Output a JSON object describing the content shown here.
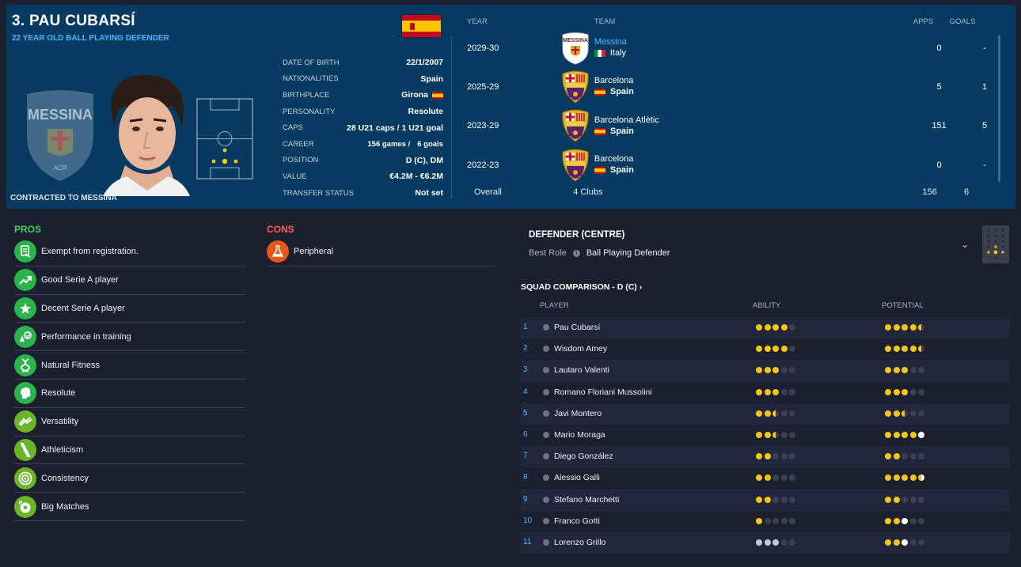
{
  "player": {
    "title": "3. PAU CUBARSÍ",
    "description": "22 YEAR OLD BALL PLAYING DEFENDER",
    "contracted": "CONTRACTED TO MESSINA",
    "nationality_flag": "spain-flag"
  },
  "info": [
    {
      "label": "DATE OF BIRTH",
      "value": "22/1/2007"
    },
    {
      "label": "NATIONALITIES",
      "value": "Spain"
    },
    {
      "label": "BIRTHPLACE",
      "value": "Girona"
    },
    {
      "label": "PERSONALITY",
      "value": "Resolute"
    },
    {
      "label": "CAPS",
      "value": "28 U21 caps / 1 U21 goal"
    },
    {
      "label": "CAREER",
      "games": "156 games /",
      "goals": "6  goals"
    },
    {
      "label": "POSITION",
      "value": "D (C), DM"
    },
    {
      "label": "VALUE",
      "value": "€4.2M - €6.2M"
    },
    {
      "label": "TRANSFER STATUS",
      "value": "Not set"
    }
  ],
  "career": {
    "headers": {
      "year": "YEAR",
      "team": "TEAM",
      "apps": "APPS",
      "goals": "GOALS"
    },
    "rows": [
      {
        "year": "2029-30",
        "team": "Messina",
        "nation": "Italy",
        "apps": "0",
        "goals": "-"
      },
      {
        "year": "2025-29",
        "team": "Barcelona",
        "nation": "Spain",
        "apps": "5",
        "goals": "1"
      },
      {
        "year": "2023-29",
        "team": "Barcelona Atlètic",
        "nation": "Spain",
        "apps": "151",
        "goals": "5"
      },
      {
        "year": "2022-23",
        "team": "Barcelona",
        "nation": "Spain",
        "apps": "0",
        "goals": "-"
      }
    ],
    "overall": {
      "label": "Overall",
      "team": "4 Clubs",
      "apps": "156",
      "goals": "6"
    }
  },
  "pros": {
    "title": "PROS",
    "items": [
      {
        "label": "Exempt from registration.",
        "icon": "document-icon",
        "color": "#2bb34d"
      },
      {
        "label": "Good Serie A player",
        "icon": "trend-up-icon",
        "color": "#2bb34d"
      },
      {
        "label": "Decent Serie A player",
        "icon": "star-icon",
        "color": "#2bb34d"
      },
      {
        "label": "Performance in training",
        "icon": "training-icon",
        "color": "#2bb34d"
      },
      {
        "label": "Natural Fitness",
        "icon": "dna-icon",
        "color": "#2bb34d"
      },
      {
        "label": "Resolute",
        "icon": "head-icon",
        "color": "#2bb34d"
      },
      {
        "label": "Versatility",
        "icon": "arrows-icon",
        "color": "#6ab52a"
      },
      {
        "label": "Athleticism",
        "icon": "bolt-icon",
        "color": "#6ab52a"
      },
      {
        "label": "Consistency",
        "icon": "target-icon",
        "color": "#6ab52a"
      },
      {
        "label": "Big Matches",
        "icon": "ball-icon",
        "color": "#6ab52a"
      }
    ]
  },
  "cons": {
    "title": "CONS",
    "items": [
      {
        "label": "Peripheral",
        "icon": "flask-icon",
        "color": "#e8561b"
      }
    ]
  },
  "position": {
    "title": "DEFENDER (CENTRE)",
    "best_role_label": "Best Role",
    "best_role": "Ball Playing Defender"
  },
  "squad": {
    "title": "SQUAD COMPARISON - D (C)",
    "headers": {
      "player": "PLAYER",
      "ability": "ABILITY",
      "potential": "POTENTIAL"
    },
    "rows": [
      {
        "num": "1",
        "name": "Pau Cubarsí",
        "ability": 4,
        "potential": 4.5
      },
      {
        "num": "2",
        "name": "Wisdom Amey",
        "ability": 4,
        "potential": 4.5
      },
      {
        "num": "3",
        "name": "Lautaro Valenti",
        "ability": 3,
        "potential": 3
      },
      {
        "num": "4",
        "name": "Romano Floriani Mussolini",
        "ability": 3,
        "potential": 3
      },
      {
        "num": "5",
        "name": "Javi Montero",
        "ability": 2.5,
        "potential": 2.5
      },
      {
        "num": "6",
        "name": "Mario Moraga",
        "ability": 2.5,
        "potential": 5,
        "potential_note": "scouted-range"
      },
      {
        "num": "7",
        "name": "Diego González",
        "ability": 2,
        "potential": 2
      },
      {
        "num": "8",
        "name": "Alessio Galli",
        "ability": 2,
        "potential": 4.5,
        "potential_note": "scouted-range"
      },
      {
        "num": "9",
        "name": "Stefano Marchetti",
        "ability": 2,
        "potential": 2
      },
      {
        "num": "10",
        "name": "Franco Gotti",
        "ability": 1,
        "potential": 3,
        "potential_note": "scouted-range"
      },
      {
        "num": "11",
        "name": "Lorenzo Grillo",
        "ability": 3,
        "ability_note": "unknown",
        "potential": 3,
        "potential_note": "scouted-range"
      }
    ]
  },
  "colors": {
    "header_bg": "#063a60",
    "page_bg": "#1c1f2e",
    "accent_blue": "#4fb3ff",
    "pros_green": "#38d35c",
    "cons_red": "#ff5f57",
    "star_gold": "#f5c518"
  }
}
